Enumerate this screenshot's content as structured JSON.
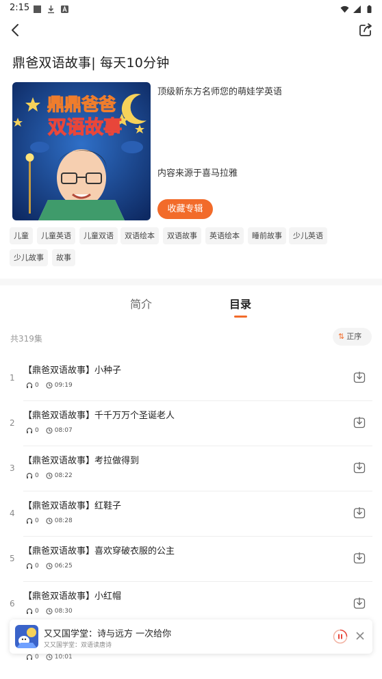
{
  "status_bar": {
    "time": "2:15",
    "left_icons": [
      "square-icon",
      "download-icon",
      "font-icon"
    ],
    "right_icons": [
      "wifi-icon",
      "signal-icon",
      "battery-icon"
    ]
  },
  "nav": {
    "back_icon": "back-arrow-icon",
    "share_icon": "share-icon"
  },
  "album": {
    "title": "鼎爸双语故事| 每天10分钟",
    "description": "顶级新东方名师您的萌娃学英语",
    "source": "内容来源于喜马拉雅",
    "collect_label": "收藏专辑"
  },
  "tags": [
    "儿童",
    "儿童英语",
    "儿童双语",
    "双语绘本",
    "双语故事",
    "英语绘本",
    "睡前故事",
    "少儿英语",
    "少儿故事",
    "故事"
  ],
  "tabs": [
    {
      "label": "简介",
      "active": false
    },
    {
      "label": "目录",
      "active": true
    }
  ],
  "list_header": {
    "count": "共319集",
    "sort_label": "正序"
  },
  "episodes": [
    {
      "num": "1",
      "title": "【鼎爸双语故事】小种子",
      "plays": "0",
      "duration": "09:19"
    },
    {
      "num": "2",
      "title": "【鼎爸双语故事】千千万万个圣诞老人",
      "plays": "0",
      "duration": "08:07"
    },
    {
      "num": "3",
      "title": "【鼎爸双语故事】考拉做得到",
      "plays": "0",
      "duration": "08:22"
    },
    {
      "num": "4",
      "title": "【鼎爸双语故事】红鞋子",
      "plays": "0",
      "duration": "08:28"
    },
    {
      "num": "5",
      "title": "【鼎爸双语故事】喜欢穿破衣服的公主",
      "plays": "0",
      "duration": "06:25"
    },
    {
      "num": "6",
      "title": "【鼎爸双语故事】小红帽",
      "plays": "0",
      "duration": "08:30"
    }
  ],
  "partial_row": {
    "plays": "0",
    "duration": "10:01"
  },
  "mini_player": {
    "title": "又又国学堂：诗与远方 一次给你",
    "subtitle": "又又国学堂：双语读唐诗"
  },
  "colors": {
    "accent": "#f26b2a",
    "tag_bg": "#f4f4f4",
    "cover_bg": "#1a3f86"
  }
}
